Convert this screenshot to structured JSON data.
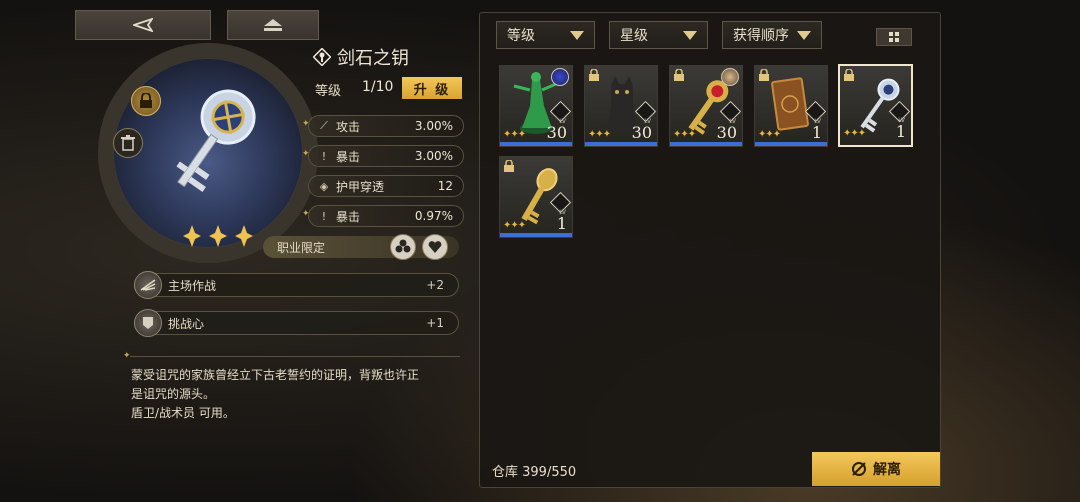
{
  "nav": {
    "back_icon": "back-arrow-icon",
    "home_icon": "home-icon"
  },
  "item": {
    "name": "剑石之钥",
    "level_label": "等级",
    "level_value": "1/10",
    "upgrade_label": "升 级",
    "stars": 3,
    "stats": [
      {
        "icon": "sword-icon",
        "name": "攻击",
        "value": "3.00%"
      },
      {
        "icon": "crit-icon",
        "name": "暴击",
        "value": "3.00%"
      },
      {
        "icon": "armor-pierce-icon",
        "name": "护甲穿透",
        "value": "12"
      },
      {
        "icon": "crit-icon",
        "name": "暴击",
        "value": "0.97%"
      }
    ],
    "class_limit_label": "职业限定",
    "skills": [
      {
        "icon": "wing-icon",
        "name": "主场作战",
        "value": "+2"
      },
      {
        "icon": "shield-icon",
        "name": "挑战心",
        "value": "+1"
      }
    ],
    "description_line1": "蒙受诅咒的家族曾经立下古老誓约的证明，背叛也许正",
    "description_line2": "是诅咒的源头。",
    "description_line3": "盾卫/战术员 可用。"
  },
  "filters": {
    "level": "等级",
    "star": "星级",
    "order": "获得顺序"
  },
  "inventory": [
    {
      "lv_tag": "LV",
      "level": "30",
      "stars": 3,
      "locked": false,
      "has_avatar": true,
      "art": "green-figure"
    },
    {
      "lv_tag": "LV",
      "level": "30",
      "stars": 3,
      "locked": true,
      "has_avatar": false,
      "art": "cat-statue"
    },
    {
      "lv_tag": "LV",
      "level": "30",
      "stars": 3,
      "locked": true,
      "has_avatar": true,
      "art": "red-key"
    },
    {
      "lv_tag": "LV",
      "level": "1",
      "stars": 3,
      "locked": true,
      "has_avatar": false,
      "art": "book"
    },
    {
      "lv_tag": "LV",
      "level": "1",
      "stars": 3,
      "locked": true,
      "has_avatar": false,
      "art": "blue-key",
      "selected": true
    },
    {
      "lv_tag": "LV",
      "level": "1",
      "stars": 3,
      "locked": true,
      "has_avatar": false,
      "art": "gold-key"
    }
  ],
  "storage": {
    "label": "仓库 399/550"
  },
  "dismantle_label": "解离",
  "colors": {
    "accent_gold": "#f0c350",
    "level_bar_blue": "#3c6ed6"
  }
}
